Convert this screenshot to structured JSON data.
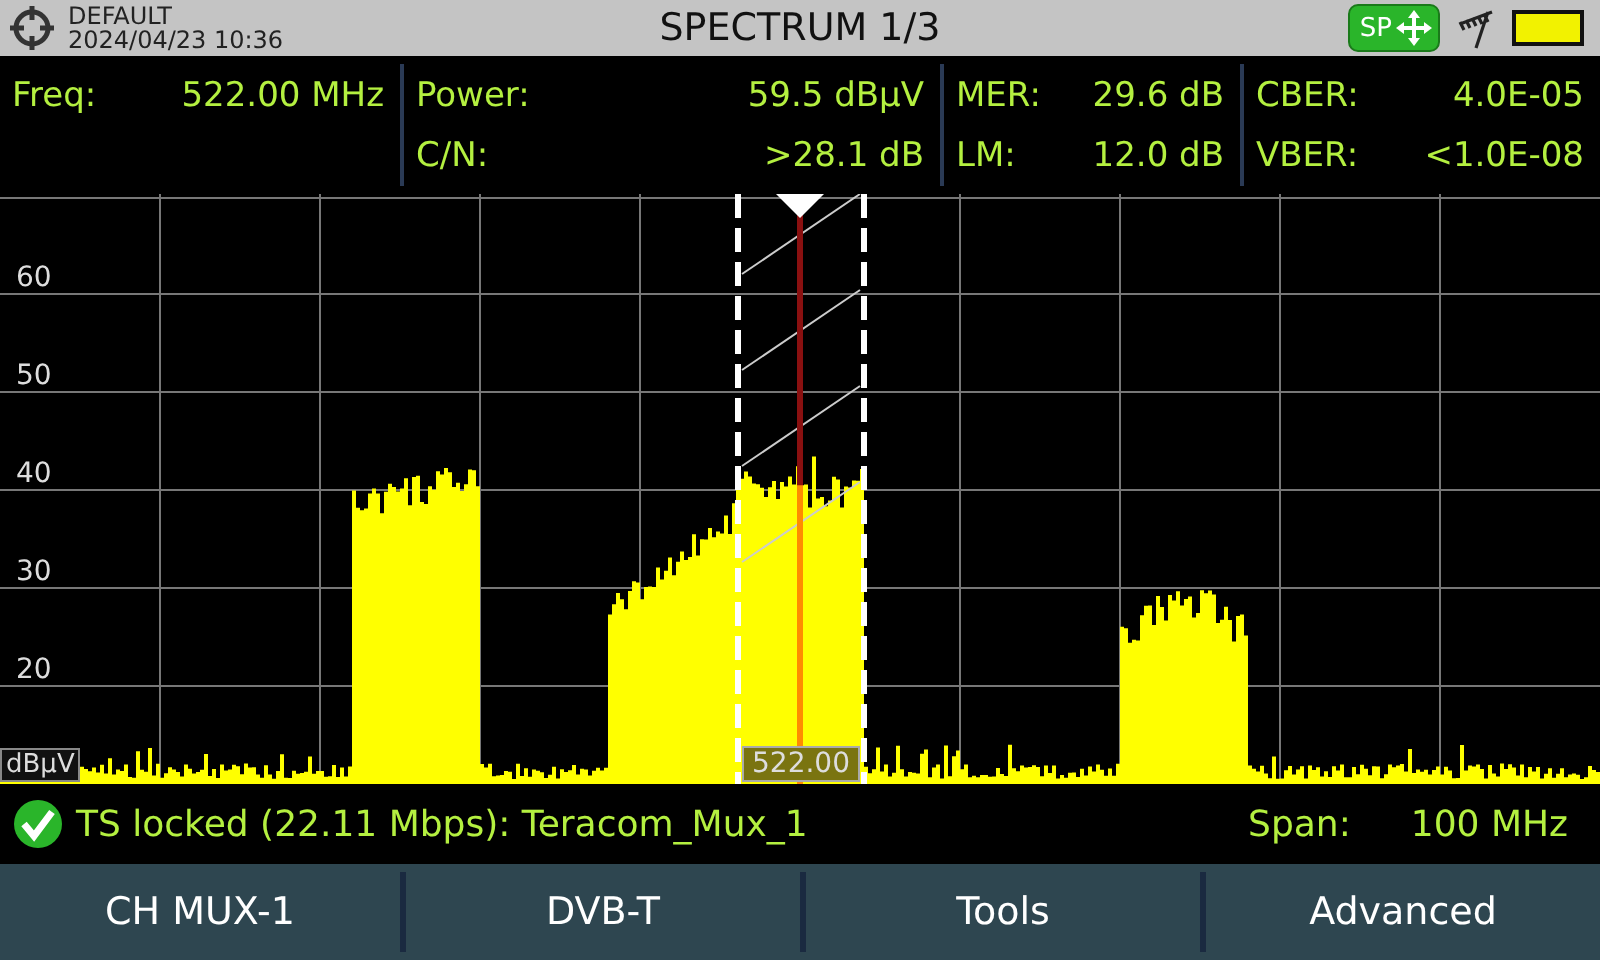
{
  "header": {
    "profile": "DEFAULT",
    "datetime": "2024/04/23 10:36",
    "title": "SPECTRUM 1/3",
    "mode_badge": "SP"
  },
  "measurements": [
    {
      "items": [
        {
          "label": "Freq:",
          "value": "522.00 MHz"
        }
      ]
    },
    {
      "items": [
        {
          "label": "Power:",
          "value": "59.5 dBµV"
        },
        {
          "label": "C/N:",
          "value": ">28.1 dB"
        }
      ]
    },
    {
      "items": [
        {
          "label": "MER:",
          "value": "29.6 dB"
        },
        {
          "label": "LM:",
          "value": "12.0 dB"
        }
      ]
    },
    {
      "items": [
        {
          "label": "CBER:",
          "value": "4.0E-05"
        },
        {
          "label": "VBER:",
          "value": "<1.0E-08"
        }
      ]
    }
  ],
  "graph": {
    "y_labels": [
      "60",
      "50",
      "40",
      "30",
      "20"
    ],
    "unit": "dBµV",
    "marker_label": "522.00"
  },
  "status": {
    "lock_text": "TS locked (22.11 Mbps): Teracom_Mux_1",
    "locked": true,
    "span_label": "Span:",
    "span_value": "100 MHz"
  },
  "buttons": [
    "CH MUX-1",
    "DVB-T",
    "Tools",
    "Advanced"
  ]
}
